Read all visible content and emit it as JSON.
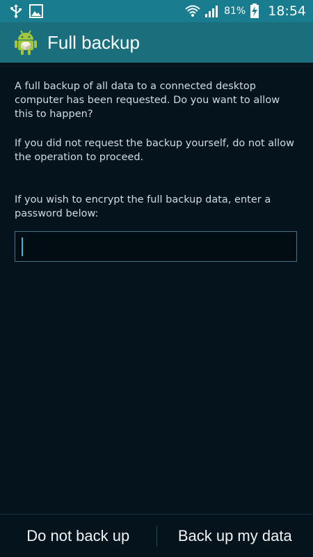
{
  "status_bar": {
    "battery_percent": "81%",
    "time": "18:54",
    "icons": [
      "usb-icon",
      "image-notification-icon",
      "wifi-icon",
      "signal-icon",
      "battery-charging-icon"
    ]
  },
  "header": {
    "title": "Full backup",
    "icon": "android-icon"
  },
  "content": {
    "paragraph_1": "A full backup of all data to a connected desktop computer has been requested. Do you want to allow this to happen?",
    "paragraph_2": "If you did not request the backup yourself, do not allow the operation to proceed.",
    "paragraph_3": "If you wish to encrypt the full backup data, enter a password below:",
    "password_value": "",
    "password_placeholder": ""
  },
  "buttons": {
    "deny_label": "Do not back up",
    "allow_label": "Back up my data"
  },
  "colors": {
    "status_bar": "#1a7d8f",
    "action_bar": "#1b6f7d",
    "background": "#04131c",
    "caret": "#3fb6d4"
  }
}
